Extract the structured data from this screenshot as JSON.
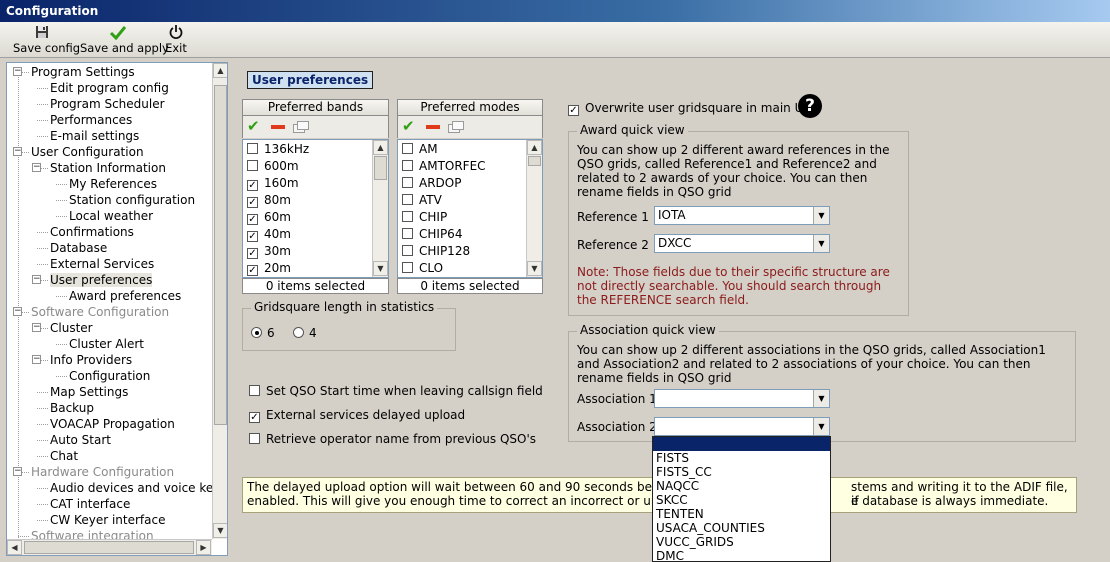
{
  "window": {
    "title": "Configuration"
  },
  "toolbar": {
    "save_config": "Save config",
    "save_and_apply": "Save and apply",
    "exit": "Exit"
  },
  "tree": {
    "items": [
      {
        "label": "Program Settings",
        "level": 0
      },
      {
        "label": "Edit program config",
        "level": 1
      },
      {
        "label": "Program Scheduler",
        "level": 1
      },
      {
        "label": "Performances",
        "level": 1
      },
      {
        "label": "E-mail settings",
        "level": 1
      },
      {
        "label": "User Configuration",
        "level": 0
      },
      {
        "label": "Station Information",
        "level": 1
      },
      {
        "label": "My References",
        "level": 2
      },
      {
        "label": "Station configuration",
        "level": 2
      },
      {
        "label": "Local weather",
        "level": 2
      },
      {
        "label": "Confirmations",
        "level": 1
      },
      {
        "label": "Database",
        "level": 1
      },
      {
        "label": "External Services",
        "level": 1
      },
      {
        "label": "User preferences",
        "level": 1
      },
      {
        "label": "Award preferences",
        "level": 2
      },
      {
        "label": "Software Configuration",
        "level": 0
      },
      {
        "label": "Cluster",
        "level": 1
      },
      {
        "label": "Cluster Alert",
        "level": 2
      },
      {
        "label": "Info Providers",
        "level": 1
      },
      {
        "label": "Configuration",
        "level": 2
      },
      {
        "label": "Map Settings",
        "level": 1
      },
      {
        "label": "Backup",
        "level": 1
      },
      {
        "label": "VOACAP Propagation",
        "level": 1
      },
      {
        "label": "Auto Start",
        "level": 1
      },
      {
        "label": "Chat",
        "level": 1
      },
      {
        "label": "Hardware Configuration",
        "level": 0
      },
      {
        "label": "Audio devices and voice keye",
        "level": 1
      },
      {
        "label": "CAT interface",
        "level": 1
      },
      {
        "label": "CW Keyer interface",
        "level": 1
      },
      {
        "label": "Software integration",
        "level": 0
      }
    ]
  },
  "section_title": "User preferences",
  "bands": {
    "header": "Preferred bands",
    "items": [
      {
        "label": "136kHz",
        "checked": false
      },
      {
        "label": "600m",
        "checked": false
      },
      {
        "label": "160m",
        "checked": true
      },
      {
        "label": "80m",
        "checked": true
      },
      {
        "label": "60m",
        "checked": true
      },
      {
        "label": "40m",
        "checked": true
      },
      {
        "label": "30m",
        "checked": true
      },
      {
        "label": "20m",
        "checked": true
      }
    ],
    "footer": "0 items selected"
  },
  "modes": {
    "header": "Preferred modes",
    "items": [
      {
        "label": "AM",
        "checked": false
      },
      {
        "label": "AMTORFEC",
        "checked": false
      },
      {
        "label": "ARDOP",
        "checked": false
      },
      {
        "label": "ATV",
        "checked": false
      },
      {
        "label": "CHIP",
        "checked": false
      },
      {
        "label": "CHIP64",
        "checked": false
      },
      {
        "label": "CHIP128",
        "checked": false
      },
      {
        "label": "CLO",
        "checked": false
      }
    ],
    "footer": "0 items selected"
  },
  "gridsquare": {
    "legend": "Gridsquare length in statistics",
    "option_6": "6",
    "option_4": "4",
    "selected": "6"
  },
  "options": {
    "set_qso_start": "Set QSO Start time when leaving callsign field",
    "set_qso_start_checked": false,
    "external_delayed": "External services delayed upload",
    "external_delayed_checked": true,
    "retrieve_operator": "Retrieve operator name from previous QSO's",
    "retrieve_operator_checked": false
  },
  "overwrite": {
    "label": "Overwrite user gridsquare in main UI",
    "checked": true
  },
  "award": {
    "legend": "Award quick view",
    "description": "You can show up 2 different award references in the QSO grids, called Reference1 and Reference2 and related to 2 awards of your choice. You can then rename fields in QSO grid",
    "ref1_label": "Reference 1",
    "ref1_value": "IOTA",
    "ref2_label": "Reference 2",
    "ref2_value": "DXCC",
    "note": "Note: Those fields due to their specific structure are not directly searchable. You should search through the REFERENCE search field."
  },
  "association": {
    "legend": "Association quick view",
    "description": "You can show up 2 different associations in the QSO grids, called Association1 and Association2 and related to 2 associations of your choice. You can then rename fields in QSO grid",
    "assoc1_label": "Association 1",
    "assoc1_value": "",
    "assoc2_label": "Association 2",
    "assoc2_value": ""
  },
  "info_text": {
    "line1_left": "The delayed upload option will wait between 60 and 90 seconds before u",
    "line1_right": "stems and writing it to the ADIF file, if",
    "line2_left": "enabled. This will give you enough time to correct an incorrect or unintent",
    "line2_right": "e database is always immediate."
  },
  "dropdown": {
    "options": [
      "",
      "FISTS",
      "FISTS_CC",
      "NAQCC",
      "SKCC",
      "TENTEN",
      "USACA_COUNTIES",
      "VUCC_GRIDS",
      "DMC"
    ],
    "selected_index": 0
  },
  "colors": {
    "note_text": "#8b1a1a",
    "info_bg": "#ffffe1",
    "selection": "#0a246a"
  }
}
